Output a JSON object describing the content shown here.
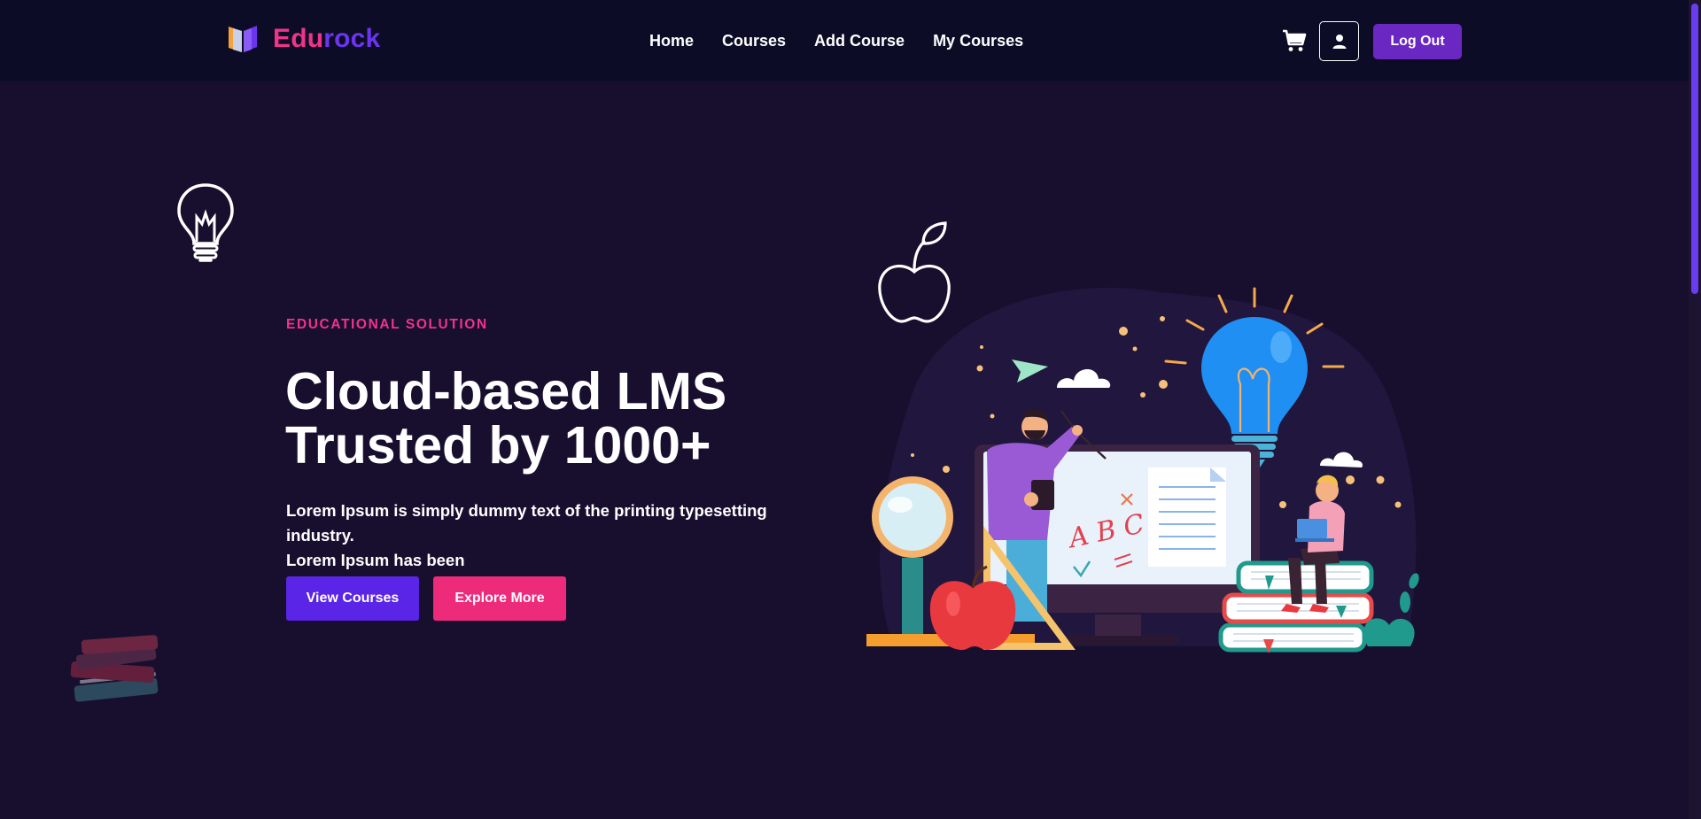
{
  "brand": {
    "name_part1": "Edu",
    "name_part2": "rock"
  },
  "nav": {
    "items": [
      {
        "label": "Home"
      },
      {
        "label": "Courses"
      },
      {
        "label": "Add Course"
      },
      {
        "label": "My Courses"
      }
    ]
  },
  "header_actions": {
    "logout_label": "Log Out"
  },
  "hero": {
    "eyebrow": "EDUCATIONAL SOLUTION",
    "title_line1": "Cloud-based LMS",
    "title_line2": "Trusted by 1000+",
    "description_line1": "Lorem Ipsum is simply dummy text of the printing typesetting industry.",
    "description_line2": "Lorem Ipsum has been",
    "primary_button": "View Courses",
    "secondary_button": "Explore More"
  },
  "illustration": {
    "board_letters": "A B C"
  },
  "colors": {
    "page_bg": "#180f2f",
    "header_bg": "#0d0c26",
    "accent_pink": "#ee2a7b",
    "accent_purple": "#5b25e8",
    "logout_purple": "#6a27c2"
  },
  "icons": [
    "book-logo-icon",
    "cart-icon",
    "user-icon",
    "lightbulb-icon",
    "apple-icon",
    "books-stack-icon"
  ]
}
